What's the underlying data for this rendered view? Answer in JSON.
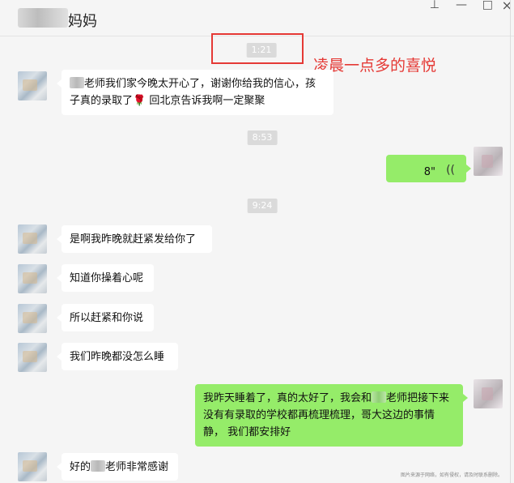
{
  "window": {
    "title_suffix": "妈妈",
    "controls": {
      "pin": "⊥",
      "minimize": "—",
      "maximize": "□",
      "close": "×"
    }
  },
  "annotation": {
    "text": "凌晨一点多的喜悦",
    "color": "#e53935"
  },
  "timestamps": [
    "1:21",
    "8:53",
    "9:24"
  ],
  "messages": [
    {
      "side": "in",
      "parts": [
        "老师我们家今晚太开心了，谢谢你给我的信心，孩",
        "子真的录取了",
        "回北京告诉我啊一定聚聚"
      ]
    },
    {
      "side": "out",
      "type": "voice",
      "duration": "8\"",
      "icon": "voice-wave-icon"
    },
    {
      "side": "in",
      "text": "是啊我昨晚就赶紧发给你了"
    },
    {
      "side": "in",
      "text": "知道你操着心呢"
    },
    {
      "side": "in",
      "text": "所以赶紧和你说"
    },
    {
      "side": "in",
      "text": "我们昨晚都没怎么睡"
    },
    {
      "side": "out",
      "parts": [
        "我昨天睡着了，真的太好了，我会和",
        "老师把接下来",
        "没有有录取的学校都再梳理梳理，哥大这边的事情静，",
        "我们都安排好"
      ]
    },
    {
      "side": "in",
      "parts": [
        "好的",
        "老师非常感谢"
      ]
    }
  ],
  "icons": {
    "rose": "🌹"
  },
  "watermark": "图片来源于网络，如有侵权，请及时联系删除。",
  "colors": {
    "bubble_out": "#95ec69",
    "bubble_in": "#ffffff",
    "background": "#f5f5f5",
    "highlight": "#e53935"
  }
}
